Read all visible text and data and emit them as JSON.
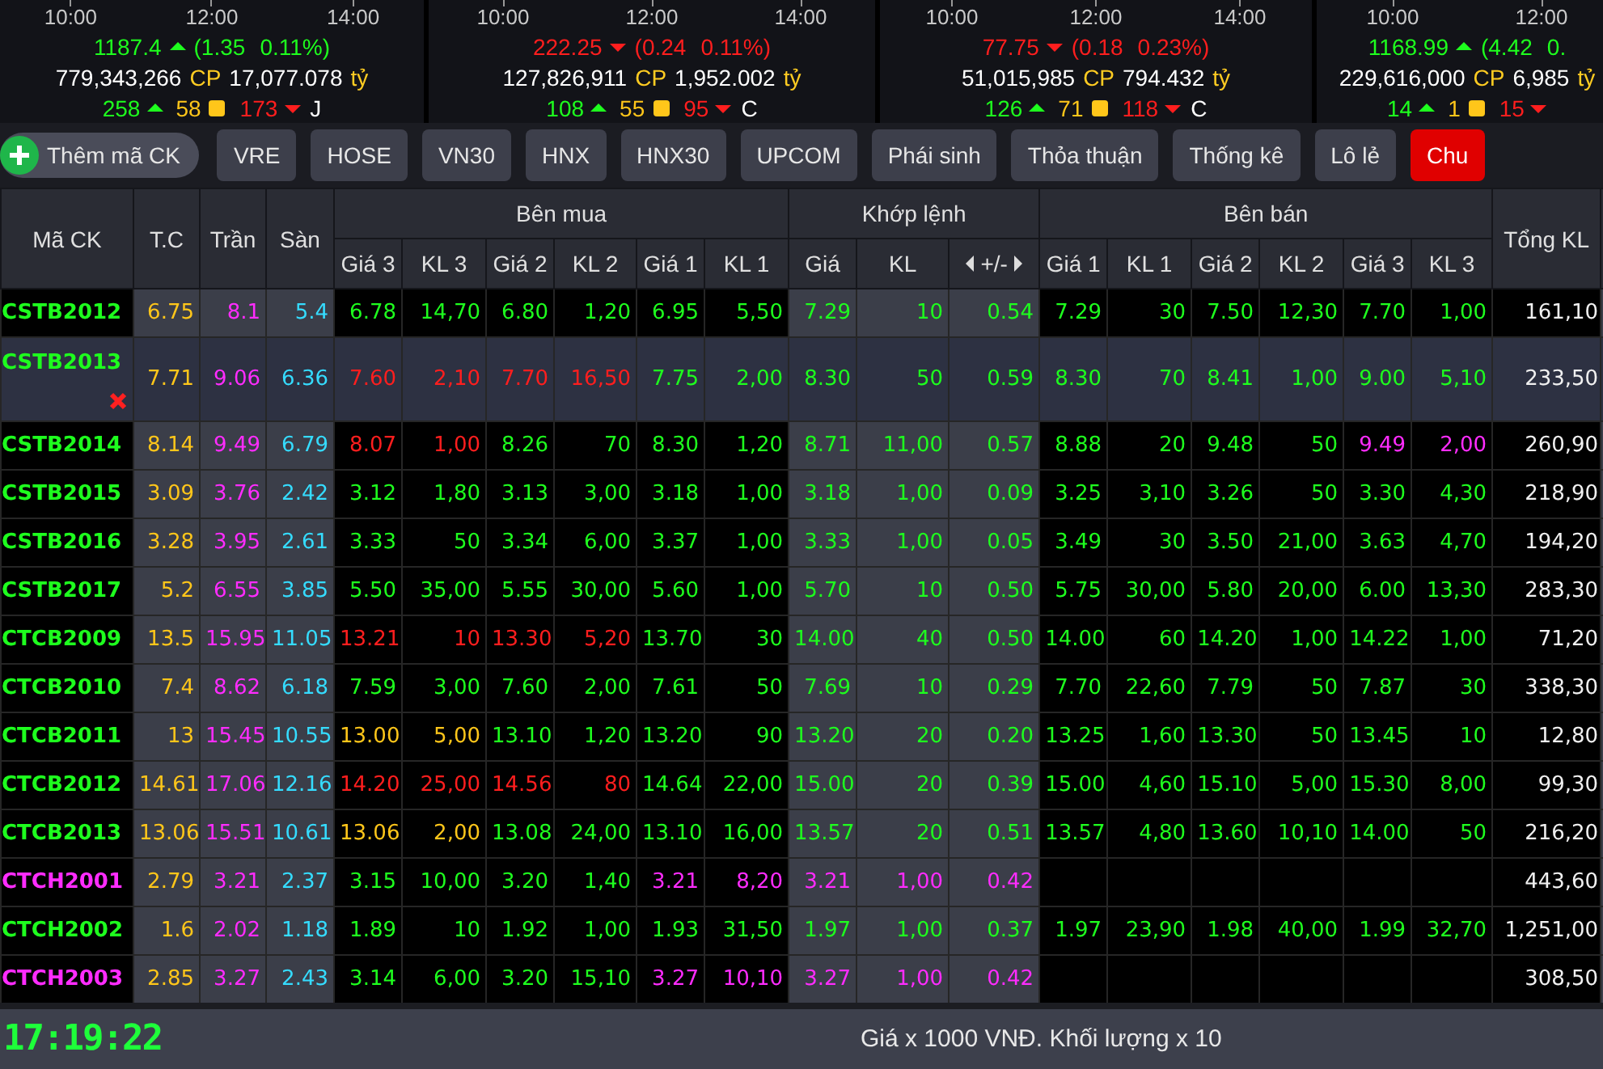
{
  "indices": [
    {
      "times": [
        "10:00",
        "12:00",
        "14:00"
      ],
      "value": "1187.4",
      "rising": true,
      "change": "(1.35",
      "percent": "0.11%)",
      "volume": "779,343,266",
      "volume_unit": "CP",
      "value_traded": "17,077.078",
      "value_unit": "tỷ",
      "advances": "258",
      "unchanged": "58",
      "declines": "173",
      "status": "J"
    },
    {
      "times": [
        "10:00",
        "12:00",
        "14:00"
      ],
      "value": "222.25",
      "rising": false,
      "change": "(0.24",
      "percent": "0.11%)",
      "volume": "127,826,911",
      "volume_unit": "CP",
      "value_traded": "1,952.002",
      "value_unit": "tỷ",
      "advances": "108",
      "unchanged": "55",
      "declines": "95",
      "status": "C"
    },
    {
      "times": [
        "10:00",
        "12:00",
        "14:00"
      ],
      "value": "77.75",
      "rising": false,
      "change": "(0.18",
      "percent": "0.23%)",
      "volume": "51,015,985",
      "volume_unit": "CP",
      "value_traded": "794.432",
      "value_unit": "tỷ",
      "advances": "126",
      "unchanged": "71",
      "declines": "118",
      "status": "C"
    },
    {
      "times": [
        "10:00",
        "12:00"
      ],
      "value": "1168.99",
      "rising": true,
      "change": "(4.42",
      "percent": "0.",
      "volume": "229,616,000",
      "volume_unit": "CP",
      "value_traded": "6,985",
      "value_unit": "tỷ",
      "advances": "14",
      "unchanged": "1",
      "declines": "15"
    }
  ],
  "add_button": "Thêm mã CK",
  "tabs": [
    {
      "label": "VRE",
      "selected": false
    },
    {
      "label": "HOSE",
      "selected": false
    },
    {
      "label": "VN30",
      "selected": false
    },
    {
      "label": "HNX",
      "selected": false
    },
    {
      "label": "HNX30",
      "selected": false
    },
    {
      "label": "UPCOM",
      "selected": false
    },
    {
      "label": "Phái sinh",
      "selected": false
    },
    {
      "label": "Thỏa thuận",
      "selected": false
    },
    {
      "label": "Thống kê",
      "selected": false
    },
    {
      "label": "Lô lẻ",
      "selected": false
    },
    {
      "label": "Chu",
      "selected": true
    }
  ],
  "table": {
    "columns": {
      "symbol": "Mã CK",
      "ref": "T.C",
      "ceiling": "Trần",
      "floor": "Sàn",
      "groups": [
        {
          "title": "Bên mua",
          "columns": [
            "Giá 3",
            "KL 3",
            "Giá 2",
            "KL 2",
            "Giá 1",
            "KL 1"
          ]
        },
        {
          "title": "Khớp lệnh",
          "columns": [
            "Giá",
            "KL",
            "+/-"
          ]
        },
        {
          "title": "Bên bán",
          "columns": [
            "Giá 1",
            "KL 1",
            "Giá 2",
            "KL 2",
            "Giá 3",
            "KL 3"
          ]
        }
      ],
      "total": "Tổng KL"
    },
    "rows": [
      {
        "symbol": "CSTB2012",
        "color": "#1eff1e",
        "selected": false,
        "ref": "6.75",
        "ceiling": "8.1",
        "floor": "5.4",
        "bid": [
          {
            "price": "6.78",
            "volume": "14,70",
            "color": "#1eff1e"
          },
          {
            "price": "6.80",
            "volume": "1,20",
            "color": "#1eff1e"
          },
          {
            "price": "6.95",
            "volume": "5,50",
            "color": "#1eff1e"
          }
        ],
        "match": {
          "price": "7.29",
          "volume": "10",
          "change": "0.54",
          "color": "#1eff1e"
        },
        "ask": [
          {
            "price": "7.29",
            "volume": "30",
            "color": "#1eff1e"
          },
          {
            "price": "7.50",
            "volume": "12,30",
            "color": "#1eff1e"
          },
          {
            "price": "7.70",
            "volume": "1,00",
            "color": "#1eff1e"
          }
        ],
        "total": "161,10"
      },
      {
        "symbol": "CSTB2013",
        "color": "#1eff1e",
        "selected": true,
        "ref": "7.71",
        "ceiling": "9.06",
        "floor": "6.36",
        "bid": [
          {
            "price": "7.60",
            "volume": "2,10",
            "color": "#ff1e1e"
          },
          {
            "price": "7.70",
            "volume": "16,50",
            "color": "#ff1e1e"
          },
          {
            "price": "7.75",
            "volume": "2,00",
            "color": "#1eff1e"
          }
        ],
        "match": {
          "price": "8.30",
          "volume": "50",
          "change": "0.59",
          "color": "#1eff1e"
        },
        "ask": [
          {
            "price": "8.30",
            "volume": "70",
            "color": "#1eff1e"
          },
          {
            "price": "8.41",
            "volume": "1,00",
            "color": "#1eff1e"
          },
          {
            "price": "9.00",
            "volume": "5,10",
            "color": "#1eff1e"
          }
        ],
        "total": "233,50"
      },
      {
        "symbol": "CSTB2014",
        "color": "#1eff1e",
        "selected": false,
        "ref": "8.14",
        "ceiling": "9.49",
        "floor": "6.79",
        "bid": [
          {
            "price": "8.07",
            "volume": "1,00",
            "color": "#ff1e1e"
          },
          {
            "price": "8.26",
            "volume": "70",
            "color": "#1eff1e"
          },
          {
            "price": "8.30",
            "volume": "1,20",
            "color": "#1eff1e"
          }
        ],
        "match": {
          "price": "8.71",
          "volume": "11,00",
          "change": "0.57",
          "color": "#1eff1e"
        },
        "ask": [
          {
            "price": "8.88",
            "volume": "20",
            "color": "#1eff1e"
          },
          {
            "price": "9.48",
            "volume": "50",
            "color": "#1eff1e"
          },
          {
            "price": "9.49",
            "volume": "2,00",
            "color": "#ff2cff"
          }
        ],
        "total": "260,90"
      },
      {
        "symbol": "CSTB2015",
        "color": "#1eff1e",
        "selected": false,
        "ref": "3.09",
        "ceiling": "3.76",
        "floor": "2.42",
        "bid": [
          {
            "price": "3.12",
            "volume": "1,80",
            "color": "#1eff1e"
          },
          {
            "price": "3.13",
            "volume": "3,00",
            "color": "#1eff1e"
          },
          {
            "price": "3.18",
            "volume": "1,00",
            "color": "#1eff1e"
          }
        ],
        "match": {
          "price": "3.18",
          "volume": "1,00",
          "change": "0.09",
          "color": "#1eff1e"
        },
        "ask": [
          {
            "price": "3.25",
            "volume": "3,10",
            "color": "#1eff1e"
          },
          {
            "price": "3.26",
            "volume": "50",
            "color": "#1eff1e"
          },
          {
            "price": "3.30",
            "volume": "4,30",
            "color": "#1eff1e"
          }
        ],
        "total": "218,90"
      },
      {
        "symbol": "CSTB2016",
        "color": "#1eff1e",
        "selected": false,
        "ref": "3.28",
        "ceiling": "3.95",
        "floor": "2.61",
        "bid": [
          {
            "price": "3.33",
            "volume": "50",
            "color": "#1eff1e"
          },
          {
            "price": "3.34",
            "volume": "6,00",
            "color": "#1eff1e"
          },
          {
            "price": "3.37",
            "volume": "1,00",
            "color": "#1eff1e"
          }
        ],
        "match": {
          "price": "3.33",
          "volume": "1,00",
          "change": "0.05",
          "color": "#1eff1e"
        },
        "ask": [
          {
            "price": "3.49",
            "volume": "30",
            "color": "#1eff1e"
          },
          {
            "price": "3.50",
            "volume": "21,00",
            "color": "#1eff1e"
          },
          {
            "price": "3.63",
            "volume": "4,70",
            "color": "#1eff1e"
          }
        ],
        "total": "194,20"
      },
      {
        "symbol": "CSTB2017",
        "color": "#1eff1e",
        "selected": false,
        "ref": "5.2",
        "ceiling": "6.55",
        "floor": "3.85",
        "bid": [
          {
            "price": "5.50",
            "volume": "35,00",
            "color": "#1eff1e"
          },
          {
            "price": "5.55",
            "volume": "30,00",
            "color": "#1eff1e"
          },
          {
            "price": "5.60",
            "volume": "1,00",
            "color": "#1eff1e"
          }
        ],
        "match": {
          "price": "5.70",
          "volume": "10",
          "change": "0.50",
          "color": "#1eff1e"
        },
        "ask": [
          {
            "price": "5.75",
            "volume": "30,00",
            "color": "#1eff1e"
          },
          {
            "price": "5.80",
            "volume": "20,00",
            "color": "#1eff1e"
          },
          {
            "price": "6.00",
            "volume": "13,30",
            "color": "#1eff1e"
          }
        ],
        "total": "283,30"
      },
      {
        "symbol": "CTCB2009",
        "color": "#1eff1e",
        "selected": false,
        "ref": "13.5",
        "ceiling": "15.95",
        "floor": "11.05",
        "bid": [
          {
            "price": "13.21",
            "volume": "10",
            "color": "#ff1e1e"
          },
          {
            "price": "13.30",
            "volume": "5,20",
            "color": "#ff1e1e"
          },
          {
            "price": "13.70",
            "volume": "30",
            "color": "#1eff1e"
          }
        ],
        "match": {
          "price": "14.00",
          "volume": "40",
          "change": "0.50",
          "color": "#1eff1e"
        },
        "ask": [
          {
            "price": "14.00",
            "volume": "60",
            "color": "#1eff1e"
          },
          {
            "price": "14.20",
            "volume": "1,00",
            "color": "#1eff1e"
          },
          {
            "price": "14.22",
            "volume": "1,00",
            "color": "#1eff1e"
          }
        ],
        "total": "71,20"
      },
      {
        "symbol": "CTCB2010",
        "color": "#1eff1e",
        "selected": false,
        "ref": "7.4",
        "ceiling": "8.62",
        "floor": "6.18",
        "bid": [
          {
            "price": "7.59",
            "volume": "3,00",
            "color": "#1eff1e"
          },
          {
            "price": "7.60",
            "volume": "2,00",
            "color": "#1eff1e"
          },
          {
            "price": "7.61",
            "volume": "50",
            "color": "#1eff1e"
          }
        ],
        "match": {
          "price": "7.69",
          "volume": "10",
          "change": "0.29",
          "color": "#1eff1e"
        },
        "ask": [
          {
            "price": "7.70",
            "volume": "22,60",
            "color": "#1eff1e"
          },
          {
            "price": "7.79",
            "volume": "50",
            "color": "#1eff1e"
          },
          {
            "price": "7.87",
            "volume": "30",
            "color": "#1eff1e"
          }
        ],
        "total": "338,30"
      },
      {
        "symbol": "CTCB2011",
        "color": "#1eff1e",
        "selected": false,
        "ref": "13",
        "ceiling": "15.45",
        "floor": "10.55",
        "bid": [
          {
            "price": "13.00",
            "volume": "5,00",
            "color": "#ffc61a"
          },
          {
            "price": "13.10",
            "volume": "1,20",
            "color": "#1eff1e"
          },
          {
            "price": "13.20",
            "volume": "90",
            "color": "#1eff1e"
          }
        ],
        "match": {
          "price": "13.20",
          "volume": "20",
          "change": "0.20",
          "color": "#1eff1e"
        },
        "ask": [
          {
            "price": "13.25",
            "volume": "1,60",
            "color": "#1eff1e"
          },
          {
            "price": "13.30",
            "volume": "50",
            "color": "#1eff1e"
          },
          {
            "price": "13.45",
            "volume": "10",
            "color": "#1eff1e"
          }
        ],
        "total": "12,80"
      },
      {
        "symbol": "CTCB2012",
        "color": "#1eff1e",
        "selected": false,
        "ref": "14.61",
        "ceiling": "17.06",
        "floor": "12.16",
        "bid": [
          {
            "price": "14.20",
            "volume": "25,00",
            "color": "#ff1e1e"
          },
          {
            "price": "14.56",
            "volume": "80",
            "color": "#ff1e1e"
          },
          {
            "price": "14.64",
            "volume": "22,00",
            "color": "#1eff1e"
          }
        ],
        "match": {
          "price": "15.00",
          "volume": "20",
          "change": "0.39",
          "color": "#1eff1e"
        },
        "ask": [
          {
            "price": "15.00",
            "volume": "4,60",
            "color": "#1eff1e"
          },
          {
            "price": "15.10",
            "volume": "5,00",
            "color": "#1eff1e"
          },
          {
            "price": "15.30",
            "volume": "8,00",
            "color": "#1eff1e"
          }
        ],
        "total": "99,30"
      },
      {
        "symbol": "CTCB2013",
        "color": "#1eff1e",
        "selected": false,
        "ref": "13.06",
        "ceiling": "15.51",
        "floor": "10.61",
        "bid": [
          {
            "price": "13.06",
            "volume": "2,00",
            "color": "#ffc61a"
          },
          {
            "price": "13.08",
            "volume": "24,00",
            "color": "#1eff1e"
          },
          {
            "price": "13.10",
            "volume": "16,00",
            "color": "#1eff1e"
          }
        ],
        "match": {
          "price": "13.57",
          "volume": "20",
          "change": "0.51",
          "color": "#1eff1e"
        },
        "ask": [
          {
            "price": "13.57",
            "volume": "4,80",
            "color": "#1eff1e"
          },
          {
            "price": "13.60",
            "volume": "10,10",
            "color": "#1eff1e"
          },
          {
            "price": "14.00",
            "volume": "50",
            "color": "#1eff1e"
          }
        ],
        "total": "216,20"
      },
      {
        "symbol": "CTCH2001",
        "color": "#ff2cff",
        "selected": false,
        "ref": "2.79",
        "ceiling": "3.21",
        "floor": "2.37",
        "bid": [
          {
            "price": "3.15",
            "volume": "10,00",
            "color": "#1eff1e"
          },
          {
            "price": "3.20",
            "volume": "1,40",
            "color": "#1eff1e"
          },
          {
            "price": "3.21",
            "volume": "8,20",
            "color": "#ff2cff"
          }
        ],
        "match": {
          "price": "3.21",
          "volume": "1,00",
          "change": "0.42",
          "color": "#ff2cff"
        },
        "total": "443,60"
      },
      {
        "symbol": "CTCH2002",
        "color": "#1eff1e",
        "selected": false,
        "ref": "1.6",
        "ceiling": "2.02",
        "floor": "1.18",
        "bid": [
          {
            "price": "1.89",
            "volume": "10",
            "color": "#1eff1e"
          },
          {
            "price": "1.92",
            "volume": "1,00",
            "color": "#1eff1e"
          },
          {
            "price": "1.93",
            "volume": "31,50",
            "color": "#1eff1e"
          }
        ],
        "match": {
          "price": "1.97",
          "volume": "1,00",
          "change": "0.37",
          "color": "#1eff1e"
        },
        "ask": [
          {
            "price": "1.97",
            "volume": "23,90",
            "color": "#1eff1e"
          },
          {
            "price": "1.98",
            "volume": "40,00",
            "color": "#1eff1e"
          },
          {
            "price": "1.99",
            "volume": "32,70",
            "color": "#1eff1e"
          }
        ],
        "total": "1,251,00"
      },
      {
        "symbol": "CTCH2003",
        "color": "#ff2cff",
        "selected": false,
        "ref": "2.85",
        "ceiling": "3.27",
        "floor": "2.43",
        "bid": [
          {
            "price": "3.14",
            "volume": "6,00",
            "color": "#1eff1e"
          },
          {
            "price": "3.20",
            "volume": "15,10",
            "color": "#1eff1e"
          },
          {
            "price": "3.27",
            "volume": "10,10",
            "color": "#ff2cff"
          }
        ],
        "match": {
          "price": "3.27",
          "volume": "1,00",
          "change": "0.42",
          "color": "#ff2cff"
        },
        "total": "308,50"
      }
    ]
  },
  "status_bar": {
    "clock": "17:19:22",
    "note": "Giá x 1000 VNĐ. Khối lượng x 10"
  }
}
